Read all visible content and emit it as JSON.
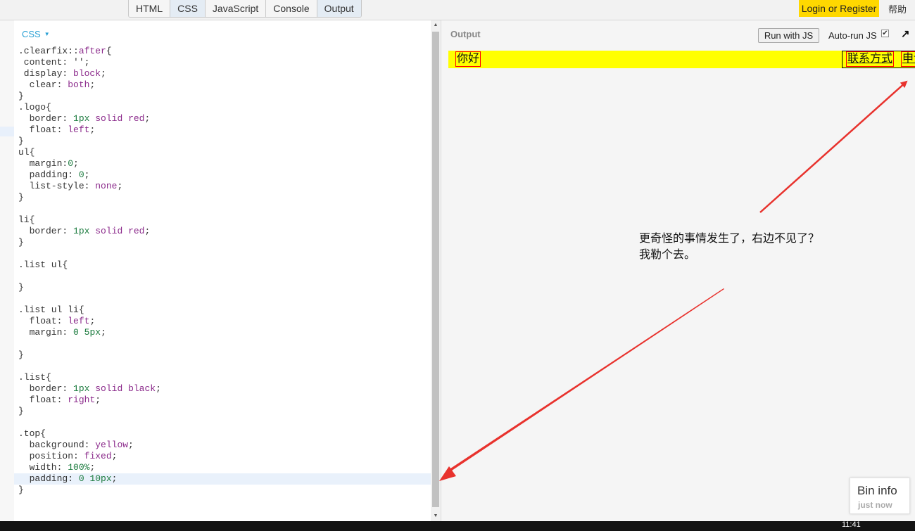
{
  "tabs": [
    "HTML",
    "CSS",
    "JavaScript",
    "Console",
    "Output"
  ],
  "login_label": "Login or Register",
  "help_label": "帮助",
  "css_panel": {
    "label": "CSS",
    "code": [
      ".clearfix::after{",
      " content: '';",
      " display: block;",
      "  clear: both;",
      "}",
      ".logo{",
      "  border: 1px solid red;",
      "  float: left;",
      "}",
      "ul{",
      "  margin:0;",
      "  padding: 0;",
      "  list-style: none;",
      "}",
      "",
      "li{",
      "  border: 1px solid red;",
      "}",
      "",
      ".list ul{",
      "",
      "}",
      "",
      ".list ul li{",
      "  float: left;",
      "  margin: 0 5px;",
      "",
      "}",
      "",
      ".list{",
      "  border: 1px solid black;",
      "  float: right;",
      "}",
      "",
      ".top{",
      "  background: yellow;",
      "  position: fixed;",
      "  width: 100%;",
      "  padding: 0 10px;",
      "}"
    ]
  },
  "output_panel": {
    "label": "Output",
    "run_button": "Run with JS",
    "autorun_label": "Auto-run JS",
    "autorun_checked": true,
    "popout_icon": "↗",
    "preview": {
      "logo_text": "你好",
      "list_items": [
        "联系方式",
        "申请"
      ],
      "background": "#ffff00"
    }
  },
  "annotation": {
    "line1": "更奇怪的事情发生了，右边不见了？",
    "line2": "我勒个去。",
    "arrow_color": "#e8322d"
  },
  "bin_info": {
    "title": "Bin info",
    "subtitle": "just now"
  },
  "taskbar": {
    "clock": "11:41"
  },
  "colors": {
    "login_bg": "#ffd800",
    "css_label": "#2aa0d4",
    "highlight_line": "#e9f1fb"
  }
}
